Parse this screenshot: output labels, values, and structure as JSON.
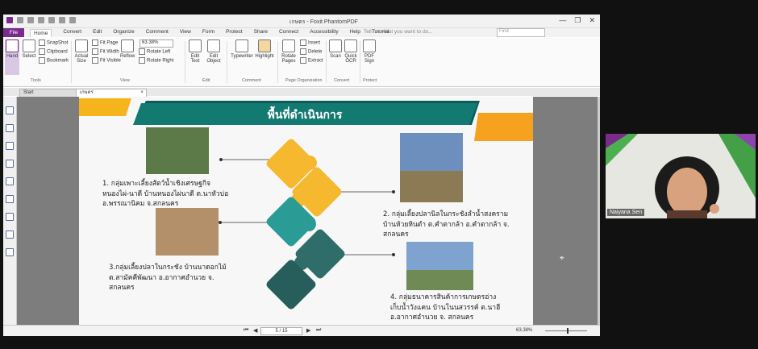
{
  "window": {
    "title": "เกษตร - Foxit PhantomPDF",
    "controls": [
      "—",
      "❐",
      "✕"
    ]
  },
  "menu": {
    "file": "File",
    "tabs": [
      "Home",
      "Convert",
      "Edit",
      "Organize",
      "Comment",
      "View",
      "Form",
      "Protect",
      "Share",
      "Connect",
      "Accessibility",
      "Help",
      "Tutorial"
    ],
    "active": "Home",
    "search_placeholder": "Tell me what you want to do...",
    "find_placeholder": "Find"
  },
  "ribbon": {
    "hand": "Hand",
    "select": "Select",
    "snapshot": "SnapShot",
    "clipboard": "Clipboard",
    "bookmark": "Bookmark",
    "tools_group": "Tools",
    "actual_size": "Actual Size",
    "fit_page": "Fit Page",
    "fit_width": "Fit Width",
    "fit_visible": "Fit Visible",
    "reflow": "Reflow",
    "zoom_value": "63.38%",
    "rotate_left": "Rotate Left",
    "rotate_right": "Rotate Right",
    "view_group": "View",
    "edit_text": "Edit Text",
    "edit_object": "Edit Object",
    "edit_group": "Edit",
    "typewriter": "Typewriter",
    "highlight": "Highlight",
    "comment_group": "Comment",
    "rotate_pages": "Rotate Pages",
    "insert": "Insert",
    "delete": "Delete",
    "extract": "Extract",
    "page_org_group": "Page Organization",
    "scan": "Scan",
    "quick_ocr": "Quick OCR",
    "convert_group": "Convert",
    "pdf_sign": "PDF Sign",
    "protect_group": "Protect"
  },
  "doc_tabs": [
    "Start",
    "เกษตร"
  ],
  "slide": {
    "title": "พื้นที่ดำเนินการ",
    "items": [
      [
        "1. กลุ่มเพาะเลี้ยงสัตว์น้ำเชิงเศรษฐกิจ",
        "หนองไผ่-นาดี บ้านหนองไผ่นาดี ต.นาหัวบ่อ",
        "อ.พรรณานิคม จ.สกลนคร"
      ],
      [
        "2. กลุ่มเลี้ยงปลานิลในกระชังลำน้ำสงคราม",
        "บ้านห้วยหินดำ ต.คำตากล้า อ.คำตากล้า จ.",
        "สกลนคร"
      ],
      [
        "3.กลุ่มเลี้ยงปลาในกระชัง บ้านนาดอกไม้",
        "ต.สามัคคีพัฒนา อ.อากาศอำนวย จ.",
        "สกลนคร"
      ],
      [
        "4. กลุ่มธนาคารสินค้าการเกษตรอ่าง",
        "เก็บน้ำวังแคน บ้านโนนสวรรค์ ต.นาฮี",
        "อ.อากาศอำนวย จ. สกลนคร"
      ]
    ]
  },
  "status": {
    "page": "5 / 15",
    "zoom": "63.38%",
    "zoom_fraction": 0.52
  },
  "video": {
    "name": "Naiyana Sen"
  },
  "colors": {
    "brand_purple": "#7a2b8c",
    "teal": "#137a72",
    "dark_teal": "#0d5b5a",
    "gold": "#f5b31c",
    "orange": "#f6a21e",
    "puzzle_yellow": "#f5b82e",
    "puzzle_teal": "#2a9c95",
    "puzzle_dark": "#2e6d6a"
  }
}
